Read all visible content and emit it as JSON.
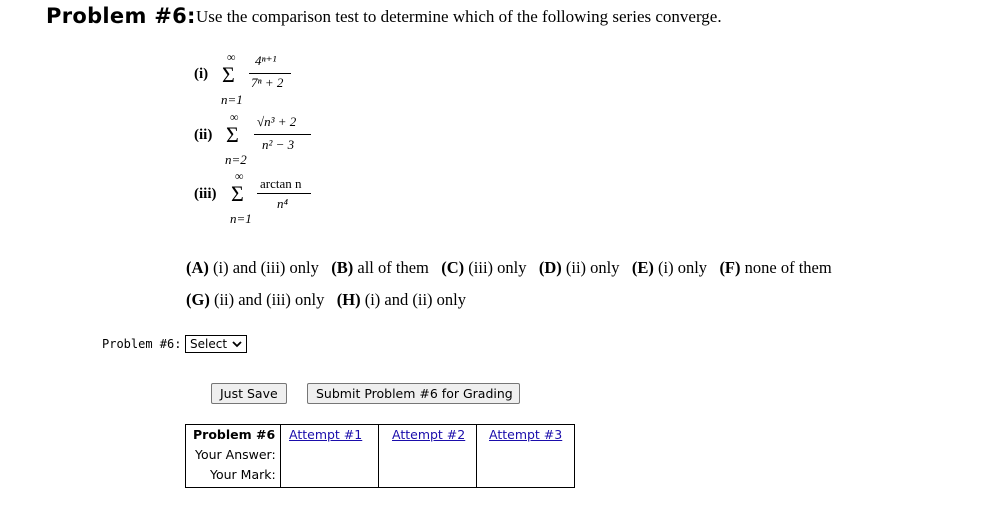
{
  "problem": {
    "title_prefix": "Problem #6:",
    "title_text": "Use the comparison test to determine which of the following series converge."
  },
  "series": [
    {
      "label": "(i)",
      "upper": "∞",
      "lower": "n=1",
      "num": "4ⁿ⁺¹",
      "den": "7ⁿ + 2"
    },
    {
      "label": "(ii)",
      "upper": "∞",
      "lower": "n=2",
      "num": "√n³ + 2",
      "den": "n² − 3"
    },
    {
      "label": "(iii)",
      "upper": "∞",
      "lower": "n=1",
      "num": "arctan n",
      "den": "n⁴"
    }
  ],
  "choices": [
    {
      "key": "(A)",
      "text": "(i) and (iii) only"
    },
    {
      "key": "(B)",
      "text": "all of them"
    },
    {
      "key": "(C)",
      "text": "(iii) only"
    },
    {
      "key": "(D)",
      "text": "(ii) only"
    },
    {
      "key": "(E)",
      "text": "(i) only"
    },
    {
      "key": "(F)",
      "text": "none of them"
    },
    {
      "key": "(G)",
      "text": "(ii) and (iii) only"
    },
    {
      "key": "(H)",
      "text": "(i) and (ii) only"
    }
  ],
  "answer": {
    "label": "Problem #6:",
    "select_value": "Select"
  },
  "buttons": {
    "save": "Just Save",
    "submit": "Submit Problem #6 for Grading"
  },
  "results": {
    "header": "Problem #6",
    "attempts": [
      "Attempt #1",
      "Attempt #2",
      "Attempt #3"
    ],
    "your_answer": "Your Answer:",
    "your_mark": "Your Mark:"
  }
}
